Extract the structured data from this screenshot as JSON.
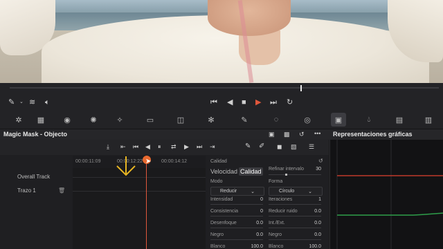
{
  "panel": {
    "title": "Magic Mask - Objecto",
    "graphs_title": "Representaciones gráficas"
  },
  "timeline": {
    "timecodes": [
      "00:00:11:09",
      "00:00:12:22",
      "00:00:14:12"
    ],
    "tracks": [
      {
        "label": "Overall Track"
      },
      {
        "label": "Trazo 1"
      }
    ]
  },
  "quality": {
    "section": "Calidad",
    "tabs": [
      "Velocidad",
      "Calidad"
    ],
    "selected_tab": "Calidad",
    "refine_label": "Refinar intervalo",
    "refine_value": "30",
    "mode_label": "Modo",
    "mode_value": "Reducir",
    "shape_label": "Forma",
    "shape_value": "Círculo",
    "params_left": [
      {
        "label": "Intensidad",
        "value": "0"
      },
      {
        "label": "Consistencia",
        "value": "0"
      },
      {
        "label": "Desenfoque",
        "value": "0.0"
      },
      {
        "label": "Negro",
        "value": "0.0"
      },
      {
        "label": "Blanco",
        "value": "100.0"
      }
    ],
    "params_right": [
      {
        "label": "Iteraciones",
        "value": "1"
      },
      {
        "label": "Reducir ruido",
        "value": "0.0"
      },
      {
        "label": "Int./Ext.",
        "value": "0.0"
      },
      {
        "label": "Negro",
        "value": "0.0"
      },
      {
        "label": "Blanco",
        "value": "100.0"
      }
    ]
  },
  "colors": {
    "accent_orange": "#e8692f",
    "playhead": "#e0573c",
    "annotation_arrow": "#e6b422",
    "graph_red": "#c0392b",
    "graph_green": "#2e9e4a"
  }
}
